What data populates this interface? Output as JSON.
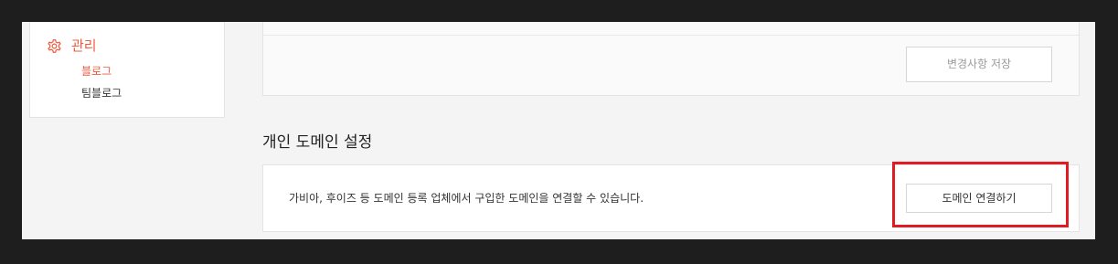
{
  "sidebar": {
    "section_label": "관리",
    "icon": "gear-icon",
    "items": [
      {
        "label": "블로그",
        "active": true
      },
      {
        "label": "팀블로그",
        "active": false
      }
    ]
  },
  "top_panel": {
    "save_button_label": "변경사항 저장"
  },
  "domain_section": {
    "title": "개인 도메인 설정",
    "description": "가비아, 후이즈 등 도메인 등록 업체에서 구입한 도메인을 연결할 수 있습니다.",
    "connect_button_label": "도메인 연결하기"
  },
  "colors": {
    "accent": "#ef5a3c",
    "highlight": "#e11b22",
    "background": "#f4f4f4"
  }
}
